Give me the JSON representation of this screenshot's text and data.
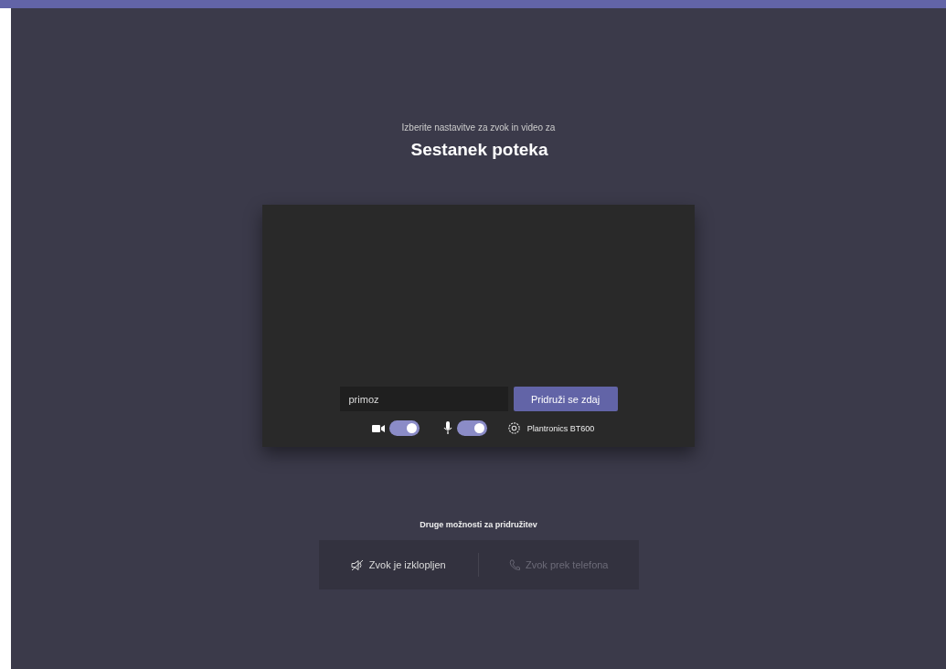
{
  "header": {
    "subtitle": "Izberite nastavitve za zvok in video za",
    "title": "Sestanek poteka"
  },
  "preview": {
    "name": {
      "value": "primoz"
    },
    "join_button": "Pridruži se zdaj",
    "camera": {
      "on": true
    },
    "microphone": {
      "on": true
    },
    "device": "Plantronics BT600"
  },
  "other_options": {
    "heading": "Druge možnosti za pridružitev",
    "options": [
      {
        "kind": "audio-off",
        "label": "Zvok je izklopljen",
        "disabled": false
      },
      {
        "kind": "phone",
        "label": "Zvok prek telefona",
        "disabled": true
      }
    ]
  }
}
